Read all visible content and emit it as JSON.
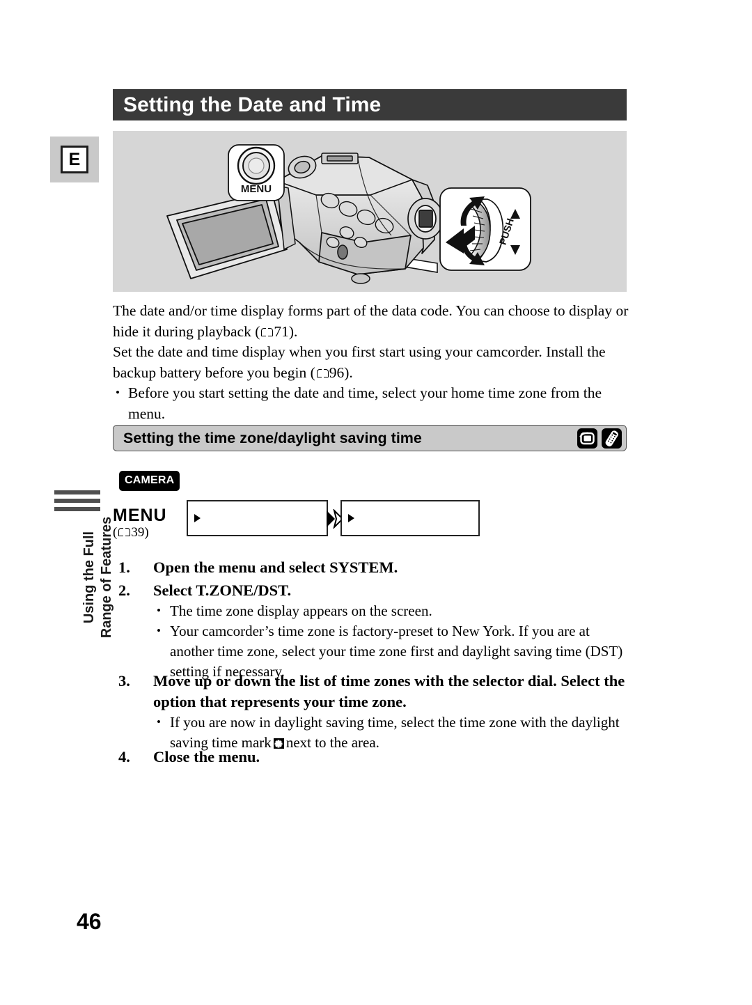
{
  "page": {
    "number": "46",
    "language_tab": "E",
    "side_tab_text": "Using the Full\nRange of Features"
  },
  "header": {
    "title": "Setting the Date and Time"
  },
  "illustration": {
    "menu_callout_label": "MENU",
    "dial_callout_label": "PUSH",
    "alt": "camcorder-with-menu-button-and-selector-dial"
  },
  "intro": {
    "paragraph_1_before_ref": "The date and/or time display forms part of the data code. You can choose to display or hide it during playback (",
    "paragraph_1_ref": "71",
    "paragraph_1_after_ref": ").",
    "paragraph_2_before_ref": "Set the date and time display when you first start using your camcorder. Install the backup battery before you begin (",
    "paragraph_2_ref": "96",
    "paragraph_2_after_ref": ").",
    "bullet_1": "Before you start setting the date and time, select your home time zone from the menu."
  },
  "subsection": {
    "heading": "Setting the time zone/daylight saving time",
    "mode_icons": [
      "playback-mode-icon",
      "remote-control-icon"
    ]
  },
  "procedure": {
    "mode_badge": "CAMERA",
    "menu_label": "MENU",
    "menu_ref_open": "(",
    "menu_ref_page": "39",
    "menu_ref_close": ")",
    "box_1_value": "",
    "box_2_value": "",
    "separator_icon": "double-chevron-right-icon"
  },
  "steps": [
    {
      "number": "1.",
      "title": "Open the menu and select SYSTEM.",
      "notes": []
    },
    {
      "number": "2.",
      "title": "Select T.ZONE/DST.",
      "notes": [
        "The time zone display appears on the screen.",
        "Your camcorder’s time zone is factory-preset to New York. If you are at another time zone, select your time zone first and daylight saving time (DST) setting if necessary."
      ]
    },
    {
      "number": "3.",
      "title": "Move up or down the list of time zones with the selector dial. Select the option that represents your time zone.",
      "notes": [],
      "note_dst_before": "If you are now in daylight saving time, select the time zone with the daylight saving time mark",
      "note_dst_after": "next to the area."
    },
    {
      "number": "4.",
      "title": "Close the menu.",
      "notes": []
    }
  ],
  "colors": {
    "title_bar": "#3a3a3a",
    "panel_gray": "#d6d6d6",
    "subhead_gray": "#c9c9c9",
    "tab_gray": "#c9c9c9",
    "rule_gray": "#4f4f4f"
  }
}
